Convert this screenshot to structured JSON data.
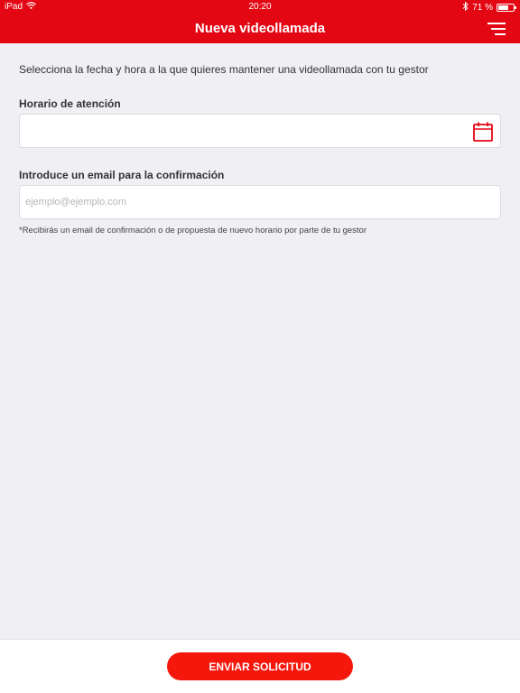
{
  "status_bar": {
    "device": "iPad",
    "time": "20:20",
    "battery": "71 %",
    "battery_level": 0.71
  },
  "nav": {
    "title": "Nueva videollamada"
  },
  "form": {
    "intro": "Selecciona la fecha y hora a la que quieres mantener una videollamada con tu gestor",
    "schedule_label": "Horario de atención",
    "schedule_value": "",
    "email_label": "Introduce un email para la confirmación",
    "email_placeholder": "ejemplo@ejemplo.com",
    "email_value": "",
    "note": "*Recibirás un email de confirmación o de propuesta de nuevo horario por parte de tu gestor"
  },
  "footer": {
    "submit_label": "ENVIAR SOLICITUD"
  },
  "colors": {
    "brand": "#e30613",
    "button": "#f5160c",
    "background": "#efeff4"
  },
  "icons": [
    "wifi-icon",
    "bluetooth-icon",
    "battery-icon",
    "menu-icon",
    "calendar-icon"
  ]
}
